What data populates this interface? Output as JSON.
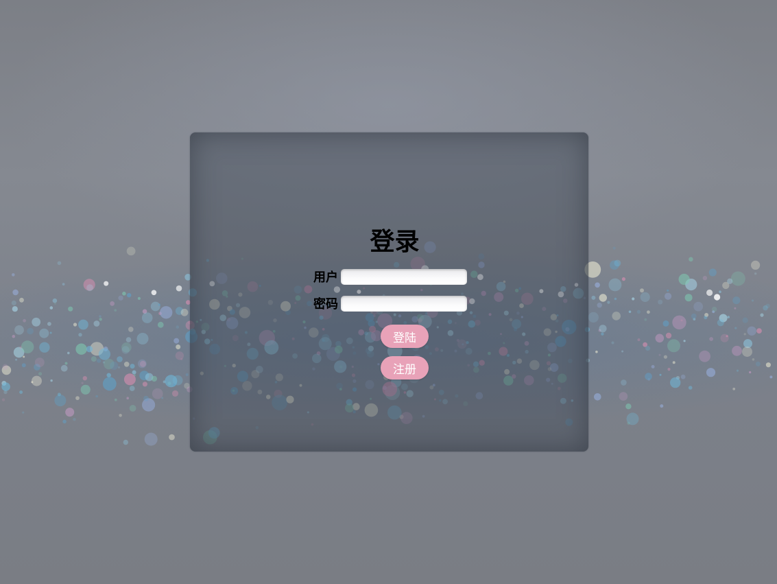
{
  "page": {
    "background_color": "#7f838a"
  },
  "login_form": {
    "title": "登录",
    "username_label": "用户",
    "username_value": "",
    "password_label": "密码",
    "password_value": "",
    "login_button_label": "登陆",
    "register_button_label": "注册",
    "button_color": "#e8a2b8",
    "button_text_color": "#ffffff"
  }
}
